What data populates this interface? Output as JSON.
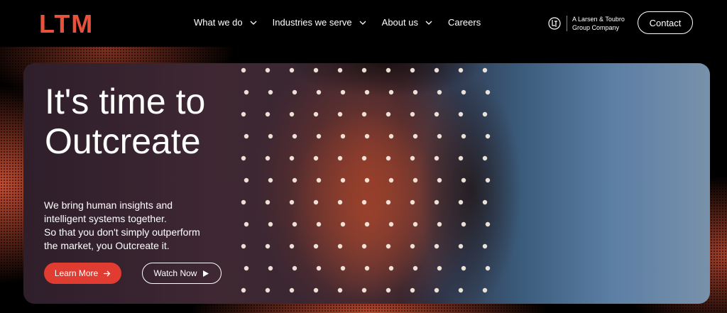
{
  "brand": {
    "logo_text": "LTM",
    "accent": "#e8513b"
  },
  "nav": {
    "items": [
      {
        "label": "What we do",
        "has_dropdown": true
      },
      {
        "label": "Industries we serve",
        "has_dropdown": true
      },
      {
        "label": "About us",
        "has_dropdown": true
      },
      {
        "label": "Careers",
        "has_dropdown": false
      }
    ],
    "group_line1": "A Larsen & Toubro",
    "group_line2": "Group Company",
    "contact_label": "Contact"
  },
  "hero": {
    "headline_line1": "It's time to",
    "headline_line2": "Outcreate",
    "sub_line1": "We bring human insights and",
    "sub_line2": "intelligent systems together.",
    "sub_line3": "So that you don't simply outperform",
    "sub_line4": "the market, you Outcreate it.",
    "learn_more_label": "Learn More",
    "watch_now_label": "Watch Now",
    "button_color": "#e03c31"
  },
  "icons": {
    "dropdown": "chevron-down-icon",
    "learn_more": "arrow-right-icon",
    "watch_now": "play-icon",
    "group": "lnt-logo-icon"
  }
}
